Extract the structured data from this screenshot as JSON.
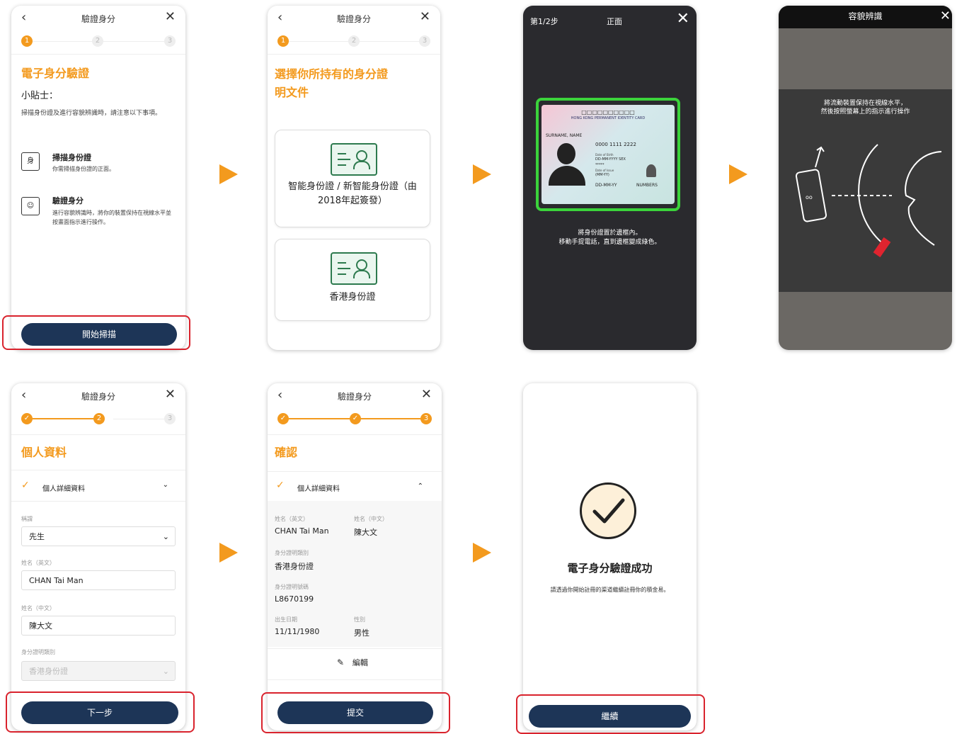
{
  "common": {
    "header_title": "驗證身分",
    "back": "‹",
    "close": "✕"
  },
  "p1": {
    "title": "電子身分驗證",
    "tips_heading": "小貼士：",
    "tips_text": "掃描身份證及進行容貌辨識時，請注意以下事項。",
    "item1_title": "掃描身份證",
    "item1_desc": "你需掃描身份證的正面。",
    "item2_title": "驗證身分",
    "item2_desc": "進行容貌辨識時，將你的裝置保持在視線水平並按畫面指示進行操作。",
    "button": "開始掃描",
    "step1": "1",
    "step2": "2",
    "step3": "3"
  },
  "p2": {
    "title": "選擇你所持有的身分證明文件",
    "card1": "智能身份證 / 新智能身份證（由2018年起簽發）",
    "card2": "香港身份證",
    "step1": "1",
    "step2": "2",
    "step3": "3"
  },
  "p3": {
    "step": "第1/2步",
    "side": "正面",
    "card_header": "HONG KONG PERMANENT IDENTITY CARD",
    "card_name": "SURNAME, NAME",
    "card_num": "0000 1111 2222",
    "card_dob_label": "Date of Birth",
    "card_dob": "DD-MM-YYYY  SEX",
    "card_stars": "*****",
    "card_issue_label": "Date of Issue",
    "card_issue": "(MM-YY)",
    "card_date": "DD-MM-YY",
    "card_numbers": "NUMBERS",
    "card_chars": "□□□□□□□□□□",
    "instr1": "將身份證置於邊框內。",
    "instr2": "移動手提電話，直到邊框變成綠色。"
  },
  "p4": {
    "title": "容貌辨識",
    "instr1": "將流動裝置保持在視線水平，",
    "instr2": "然後按照螢幕上的指示進行操作"
  },
  "p5": {
    "title": "個人資料",
    "section": "個人詳細資料",
    "label_title": "稱謂",
    "title_value": "先生",
    "label_en": "姓名（英文）",
    "en_value": "CHAN  Tai Man",
    "label_zh": "姓名（中文）",
    "zh_value": "陳大文",
    "label_doc": "身分證明類別",
    "doc_value": "香港身份證",
    "button": "下一步",
    "step3": "3"
  },
  "p6": {
    "title": "確認",
    "section": "個人詳細資料",
    "en_label": "姓名（英文）",
    "en_value": "CHAN  Tai Man",
    "zh_label": "姓名（中文）",
    "zh_value": "陳大文",
    "doc_label": "身分證明類別",
    "doc_value": "香港身份證",
    "num_label": "身分證明號碼",
    "num_value": "L8670199",
    "dob_label": "出生日期",
    "dob_value": "11/11/1980",
    "sex_label": "性別",
    "sex_value": "男性",
    "edit": "編輯",
    "button": "提交",
    "step3": "3"
  },
  "p7": {
    "title": "電子身分驗證成功",
    "desc": "請透過你開始註冊的渠道繼續註冊你的積金易。",
    "button": "繼續"
  },
  "colors": {
    "accent": "#f39a1e",
    "navy": "#1d3557",
    "highlight": "#d9232d",
    "frame": "#3bd33b"
  }
}
